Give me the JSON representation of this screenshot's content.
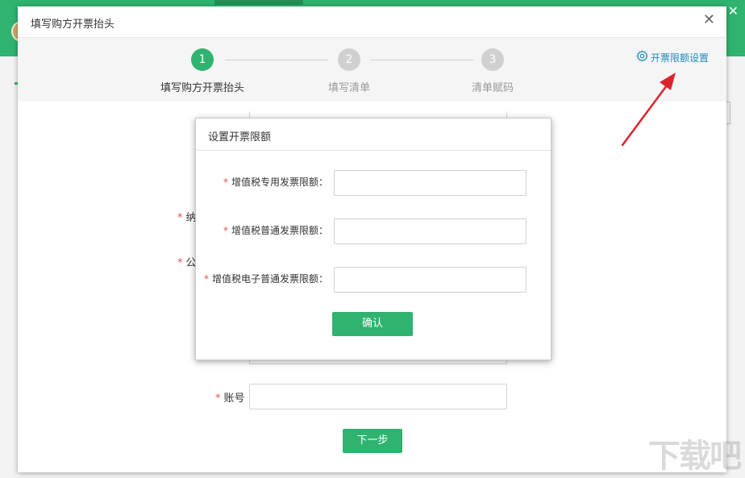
{
  "app": {
    "close_glyph": "✕"
  },
  "dialog": {
    "title": "填写购方开票抬头",
    "close_glyph": "✕",
    "steps": [
      {
        "number": "1",
        "label": "填写购方开票抬头",
        "state": "active"
      },
      {
        "number": "2",
        "label": "填写清单",
        "state": "inactive"
      },
      {
        "number": "3",
        "label": "清单赋码",
        "state": "inactive"
      }
    ],
    "settings_link": {
      "label": "开票限额设置",
      "icon": "gear-icon"
    },
    "form": {
      "required_mark": "*",
      "row_taxpayer_label_partial": "纳",
      "row_company_label_partial": "公",
      "row_account_label": "账号",
      "account_value": ""
    },
    "next_button": "下一步"
  },
  "modal": {
    "title": "设置开票限额",
    "required_mark": "*",
    "fields": [
      {
        "label": "增值税专用发票限额：",
        "value": ""
      },
      {
        "label": "增值税普通发票限额：",
        "value": ""
      },
      {
        "label": "增值税电子普通发票限额：",
        "value": ""
      }
    ],
    "confirm_button": "确认"
  },
  "watermark": "下载吧",
  "colors": {
    "brand_green": "#2fb36f",
    "link_blue": "#1f8bbf",
    "required_red": "#e84e4e",
    "annotation_red": "#d9262c"
  }
}
